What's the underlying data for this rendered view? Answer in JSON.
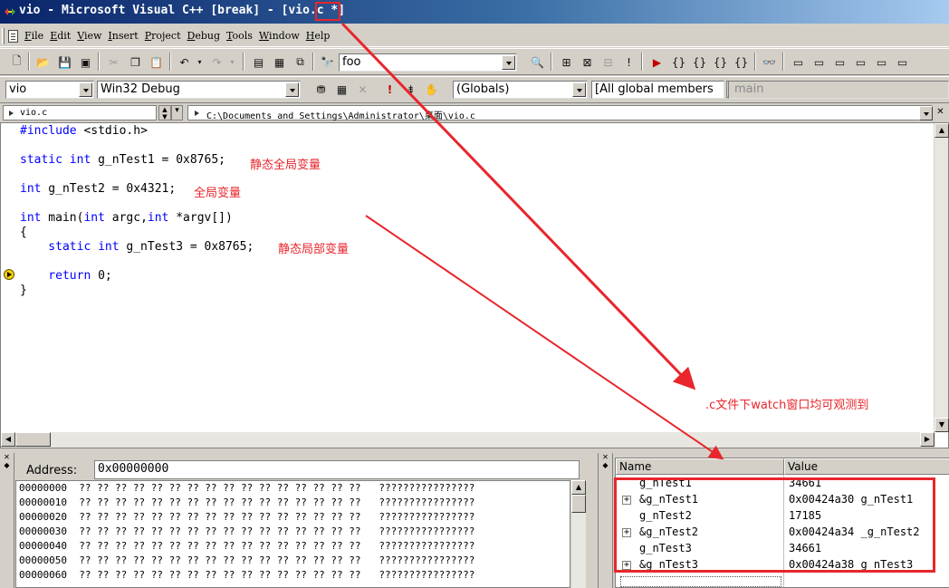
{
  "window": {
    "title": "vio - Microsoft Visual C++ [break] - [vio.c *]"
  },
  "menu": {
    "items": [
      {
        "accel": "F",
        "rest": "ile"
      },
      {
        "accel": "E",
        "rest": "dit"
      },
      {
        "accel": "V",
        "rest": "iew"
      },
      {
        "accel": "I",
        "rest": "nsert"
      },
      {
        "accel": "P",
        "rest": "roject"
      },
      {
        "accel": "D",
        "rest": "ebug"
      },
      {
        "accel": "T",
        "rest": "ools"
      },
      {
        "accel": "W",
        "rest": "indow"
      },
      {
        "accel": "H",
        "rest": "elp"
      }
    ]
  },
  "toolbar1": {
    "find_combo": "foo"
  },
  "toolbar2": {
    "project": "vio",
    "config": "Win32 Debug",
    "scope": "(Globals)",
    "members": "[All global members",
    "function": "main"
  },
  "pathbar": {
    "file": "vio.c",
    "path": "C:\\Documents and Settings\\Administrator\\桌面\\vio.c"
  },
  "editor": {
    "lines": [
      {
        "kw": "#include",
        "rest": " <stdio.h>"
      },
      {
        "kw": "static int",
        "rest": " g_nTest1 = 0x8765;"
      },
      {
        "kw": "int",
        "rest": " g_nTest2 = 0x4321;"
      },
      {
        "kw": "int",
        "rest": " main(",
        "kw2": "int",
        "rest2": " argc,",
        "kw3": "int",
        "rest3": " *argv[])"
      },
      {
        "kw": "",
        "rest": "{"
      },
      {
        "kw": "    static int",
        "rest": " g_nTest3 = 0x8765;"
      },
      {
        "kw": "    return",
        "rest": " 0;"
      },
      {
        "kw": "",
        "rest": "}"
      }
    ],
    "notes": {
      "static_global": "静态全局变量",
      "global": "全局变量",
      "static_local": "静态局部变量"
    }
  },
  "annotation": {
    "watch_note": ".c文件下watch窗口均可观测到"
  },
  "memory": {
    "address_label": "Address:",
    "address_value": "0x00000000",
    "rows": [
      {
        "addr": "00000000",
        "bytes": "?? ?? ?? ?? ?? ?? ?? ?? ?? ?? ?? ?? ?? ?? ?? ??",
        "ascii": "????????????????"
      },
      {
        "addr": "00000010",
        "bytes": "?? ?? ?? ?? ?? ?? ?? ?? ?? ?? ?? ?? ?? ?? ?? ??",
        "ascii": "????????????????"
      },
      {
        "addr": "00000020",
        "bytes": "?? ?? ?? ?? ?? ?? ?? ?? ?? ?? ?? ?? ?? ?? ?? ??",
        "ascii": "????????????????"
      },
      {
        "addr": "00000030",
        "bytes": "?? ?? ?? ?? ?? ?? ?? ?? ?? ?? ?? ?? ?? ?? ?? ??",
        "ascii": "????????????????"
      },
      {
        "addr": "00000040",
        "bytes": "?? ?? ?? ?? ?? ?? ?? ?? ?? ?? ?? ?? ?? ?? ?? ??",
        "ascii": "????????????????"
      },
      {
        "addr": "00000050",
        "bytes": "?? ?? ?? ?? ?? ?? ?? ?? ?? ?? ?? ?? ?? ?? ?? ??",
        "ascii": "????????????????"
      },
      {
        "addr": "00000060",
        "bytes": "?? ?? ?? ?? ?? ?? ?? ?? ?? ?? ?? ?? ?? ?? ?? ??",
        "ascii": "????????????????"
      }
    ]
  },
  "watch": {
    "col_name": "Name",
    "col_value": "Value",
    "rows": [
      {
        "expand": false,
        "name": "g_nTest1",
        "value": "34661"
      },
      {
        "expand": true,
        "name": "&g_nTest1",
        "value": "0x00424a30 g_nTest1"
      },
      {
        "expand": false,
        "name": "g_nTest2",
        "value": "17185"
      },
      {
        "expand": true,
        "name": "&g_nTest2",
        "value": "0x00424a34 _g_nTest2"
      },
      {
        "expand": false,
        "name": "g_nTest3",
        "value": "34661"
      },
      {
        "expand": true,
        "name": "&g_nTest3",
        "value": "0x00424a38 g_nTest3"
      }
    ]
  },
  "colors": {
    "annotation_red": "#e8262c",
    "keyword_blue": "#0000ff",
    "face": "#d4d0c8"
  }
}
